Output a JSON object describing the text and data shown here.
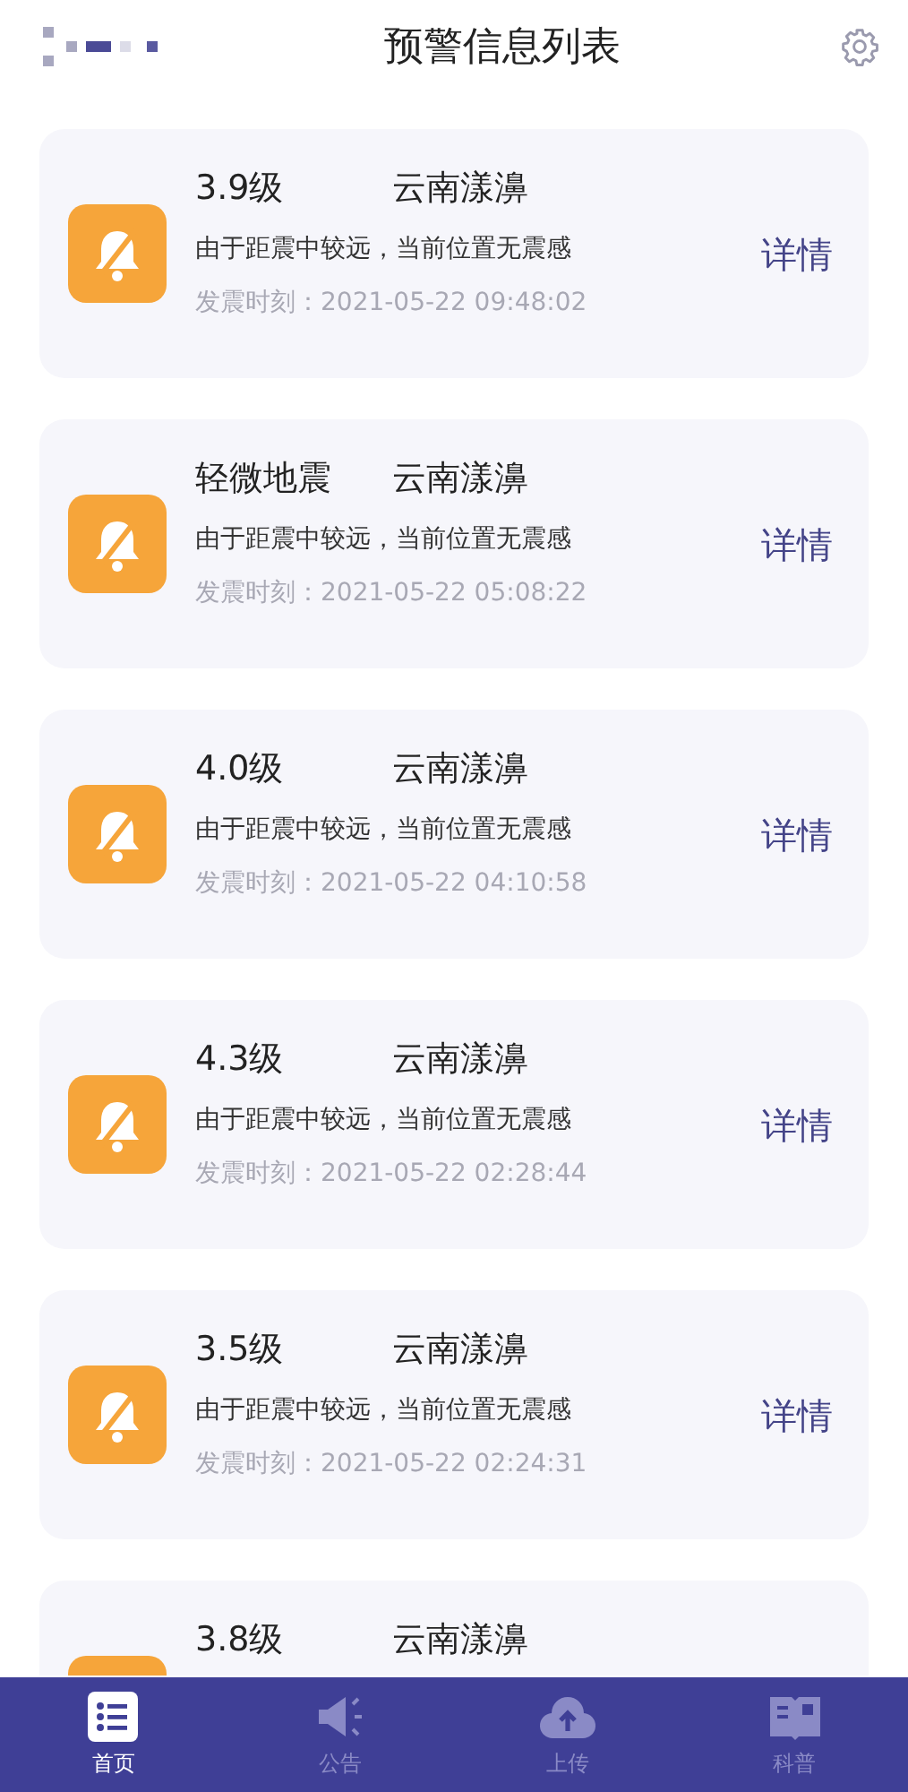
{
  "header": {
    "title": "预警信息列表"
  },
  "alerts": [
    {
      "magnitude": "3.9级",
      "location": "云南漾濞",
      "note": "由于距震中较远，当前位置无震感",
      "time": "发震时刻：2021-05-22 09:48:02",
      "action": "详情"
    },
    {
      "magnitude": "轻微地震",
      "location": "云南漾濞",
      "note": "由于距震中较远，当前位置无震感",
      "time": "发震时刻：2021-05-22 05:08:22",
      "action": "详情"
    },
    {
      "magnitude": "4.0级",
      "location": "云南漾濞",
      "note": "由于距震中较远，当前位置无震感",
      "time": "发震时刻：2021-05-22 04:10:58",
      "action": "详情"
    },
    {
      "magnitude": "4.3级",
      "location": "云南漾濞",
      "note": "由于距震中较远，当前位置无震感",
      "time": "发震时刻：2021-05-22 02:28:44",
      "action": "详情"
    },
    {
      "magnitude": "3.5级",
      "location": "云南漾濞",
      "note": "由于距震中较远，当前位置无震感",
      "time": "发震时刻：2021-05-22 02:24:31",
      "action": "详情"
    },
    {
      "magnitude": "3.8级",
      "location": "云南漾濞"
    }
  ],
  "tabbar": [
    {
      "kind": "list",
      "label": "首页",
      "selected": true
    },
    {
      "kind": "megaphone",
      "label": "公告",
      "selected": false
    },
    {
      "kind": "upload",
      "label": "上传",
      "selected": false
    },
    {
      "kind": "book",
      "label": "科普",
      "selected": false
    }
  ]
}
